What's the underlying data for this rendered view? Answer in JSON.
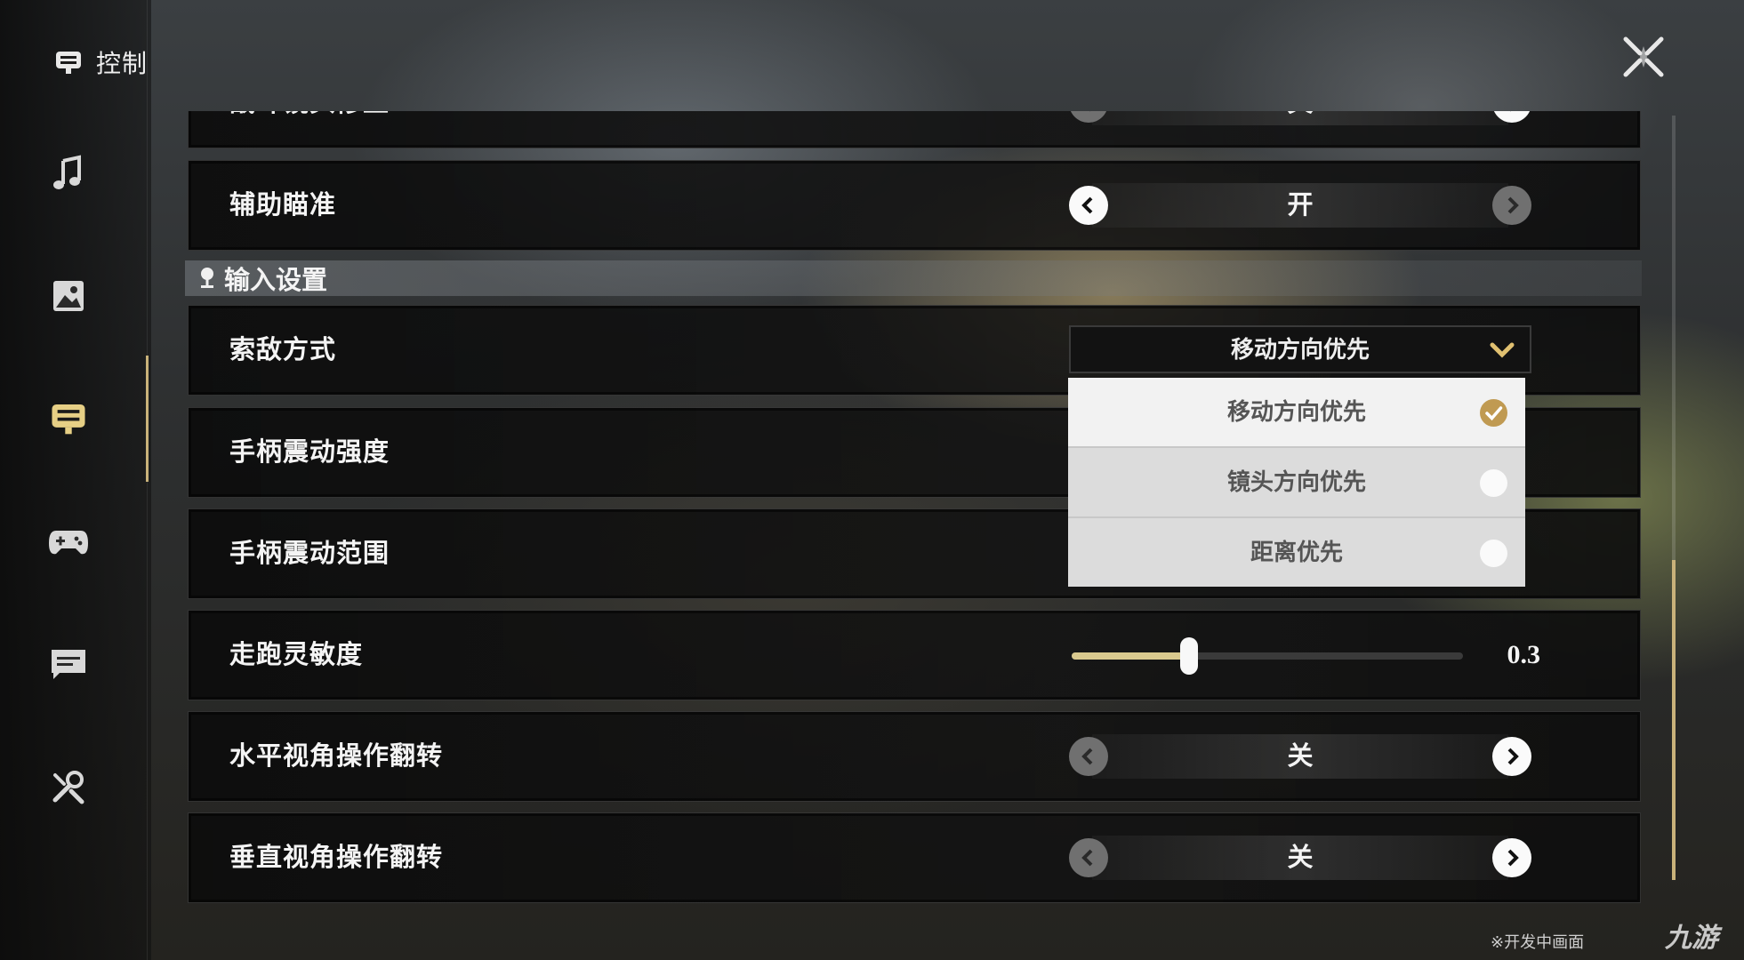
{
  "header": {
    "title": "控制",
    "icon": "controls-icon"
  },
  "sidebar": {
    "items": [
      {
        "icon": "music-note-icon",
        "active": false
      },
      {
        "icon": "image-icon",
        "active": false
      },
      {
        "icon": "controls-icon",
        "active": true
      },
      {
        "icon": "gamepad-icon",
        "active": false
      },
      {
        "icon": "chat-icon",
        "active": false
      },
      {
        "icon": "tools-icon",
        "active": false
      }
    ]
  },
  "close_icon": "close-x-icon",
  "rows": {
    "partial": {
      "label": "战斗镜头修正",
      "value": "关"
    },
    "aim_assist": {
      "label": "辅助瞄准",
      "value": "开"
    },
    "section": {
      "label": "输入设置"
    },
    "target_mode": {
      "label": "索敌方式",
      "value": "移动方向优先",
      "options": [
        {
          "label": "移动方向优先",
          "selected": true
        },
        {
          "label": "镜头方向优先",
          "selected": false
        },
        {
          "label": "距离优先",
          "selected": false
        }
      ]
    },
    "vibration_strength": {
      "label": "手柄震动强度"
    },
    "vibration_range": {
      "label": "手柄震动范围"
    },
    "run_sensitivity": {
      "label": "走跑灵敏度",
      "value": "0.3",
      "fill_fraction": 0.3
    },
    "invert_horizontal": {
      "label": "水平视角操作翻转",
      "value": "关"
    },
    "invert_vertical": {
      "label": "垂直视角操作翻转",
      "value": "关"
    }
  },
  "footer": {
    "note": "※开发中画面",
    "watermark": "九游"
  },
  "colors": {
    "accent": "#c9b27a",
    "check": "#c09a52"
  }
}
